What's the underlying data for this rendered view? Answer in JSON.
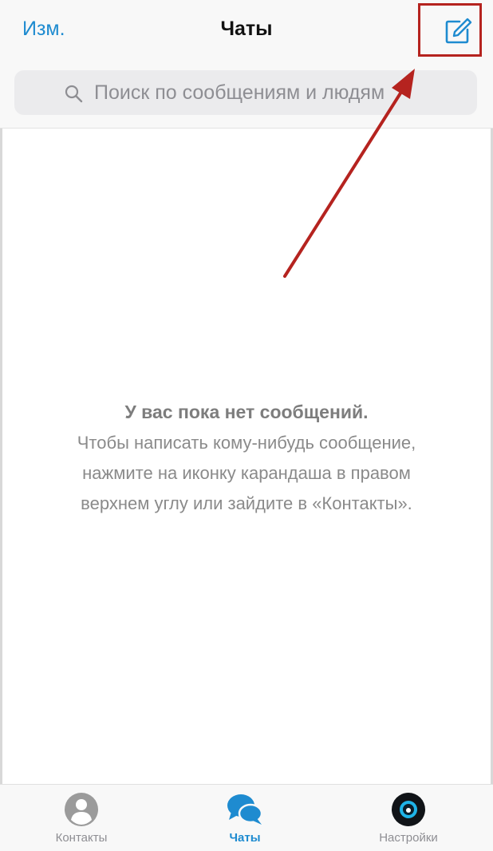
{
  "header": {
    "edit_label": "Изм.",
    "title": "Чаты",
    "search_placeholder": "Поиск по сообщениям и людям"
  },
  "empty_state": {
    "title": "У вас пока нет сообщений.",
    "line1": "Чтобы написать кому-нибудь сообщение,",
    "line2": "нажмите на иконку карандаша в правом",
    "line3": "верхнем углу или зайдите в «Контакты»."
  },
  "tabs": [
    {
      "label": "Контакты",
      "icon": "person-icon",
      "active": false
    },
    {
      "label": "Чаты",
      "icon": "chat-bubbles-icon",
      "active": true
    },
    {
      "label": "Настройки",
      "icon": "avatar-icon",
      "active": false
    }
  ],
  "colors": {
    "accent": "#1e8bd0",
    "annotation": "#b5231f",
    "inactive": "#8e8e93"
  }
}
